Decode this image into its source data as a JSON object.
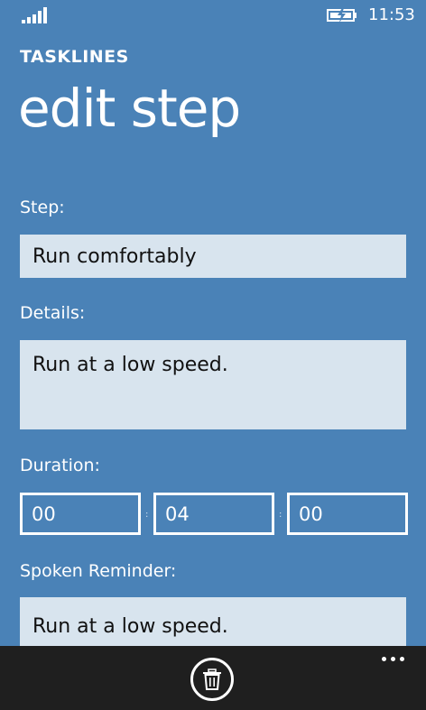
{
  "status": {
    "time": "11:53",
    "signal_icon": "signal-strength-icon",
    "battery_icon": "battery-charging-icon"
  },
  "header": {
    "app_name": "TASKLINES",
    "title": "edit step"
  },
  "form": {
    "step_label": "Step:",
    "step_value": "Run comfortably",
    "details_label": "Details:",
    "details_value": "Run at a low speed.",
    "duration_label": "Duration:",
    "duration": {
      "hours": "00",
      "minutes": "04",
      "seconds": "00",
      "separator": ":"
    },
    "reminder_label": "Spoken Reminder:",
    "reminder_value": "Run at a low speed."
  },
  "app_bar": {
    "delete_icon": "trash-icon",
    "more_icon": "ellipsis-icon"
  },
  "colors": {
    "background": "#4a82b7",
    "input_fill": "#d8e4ee",
    "app_bar": "#1f1f1f",
    "text": "#ffffff"
  }
}
